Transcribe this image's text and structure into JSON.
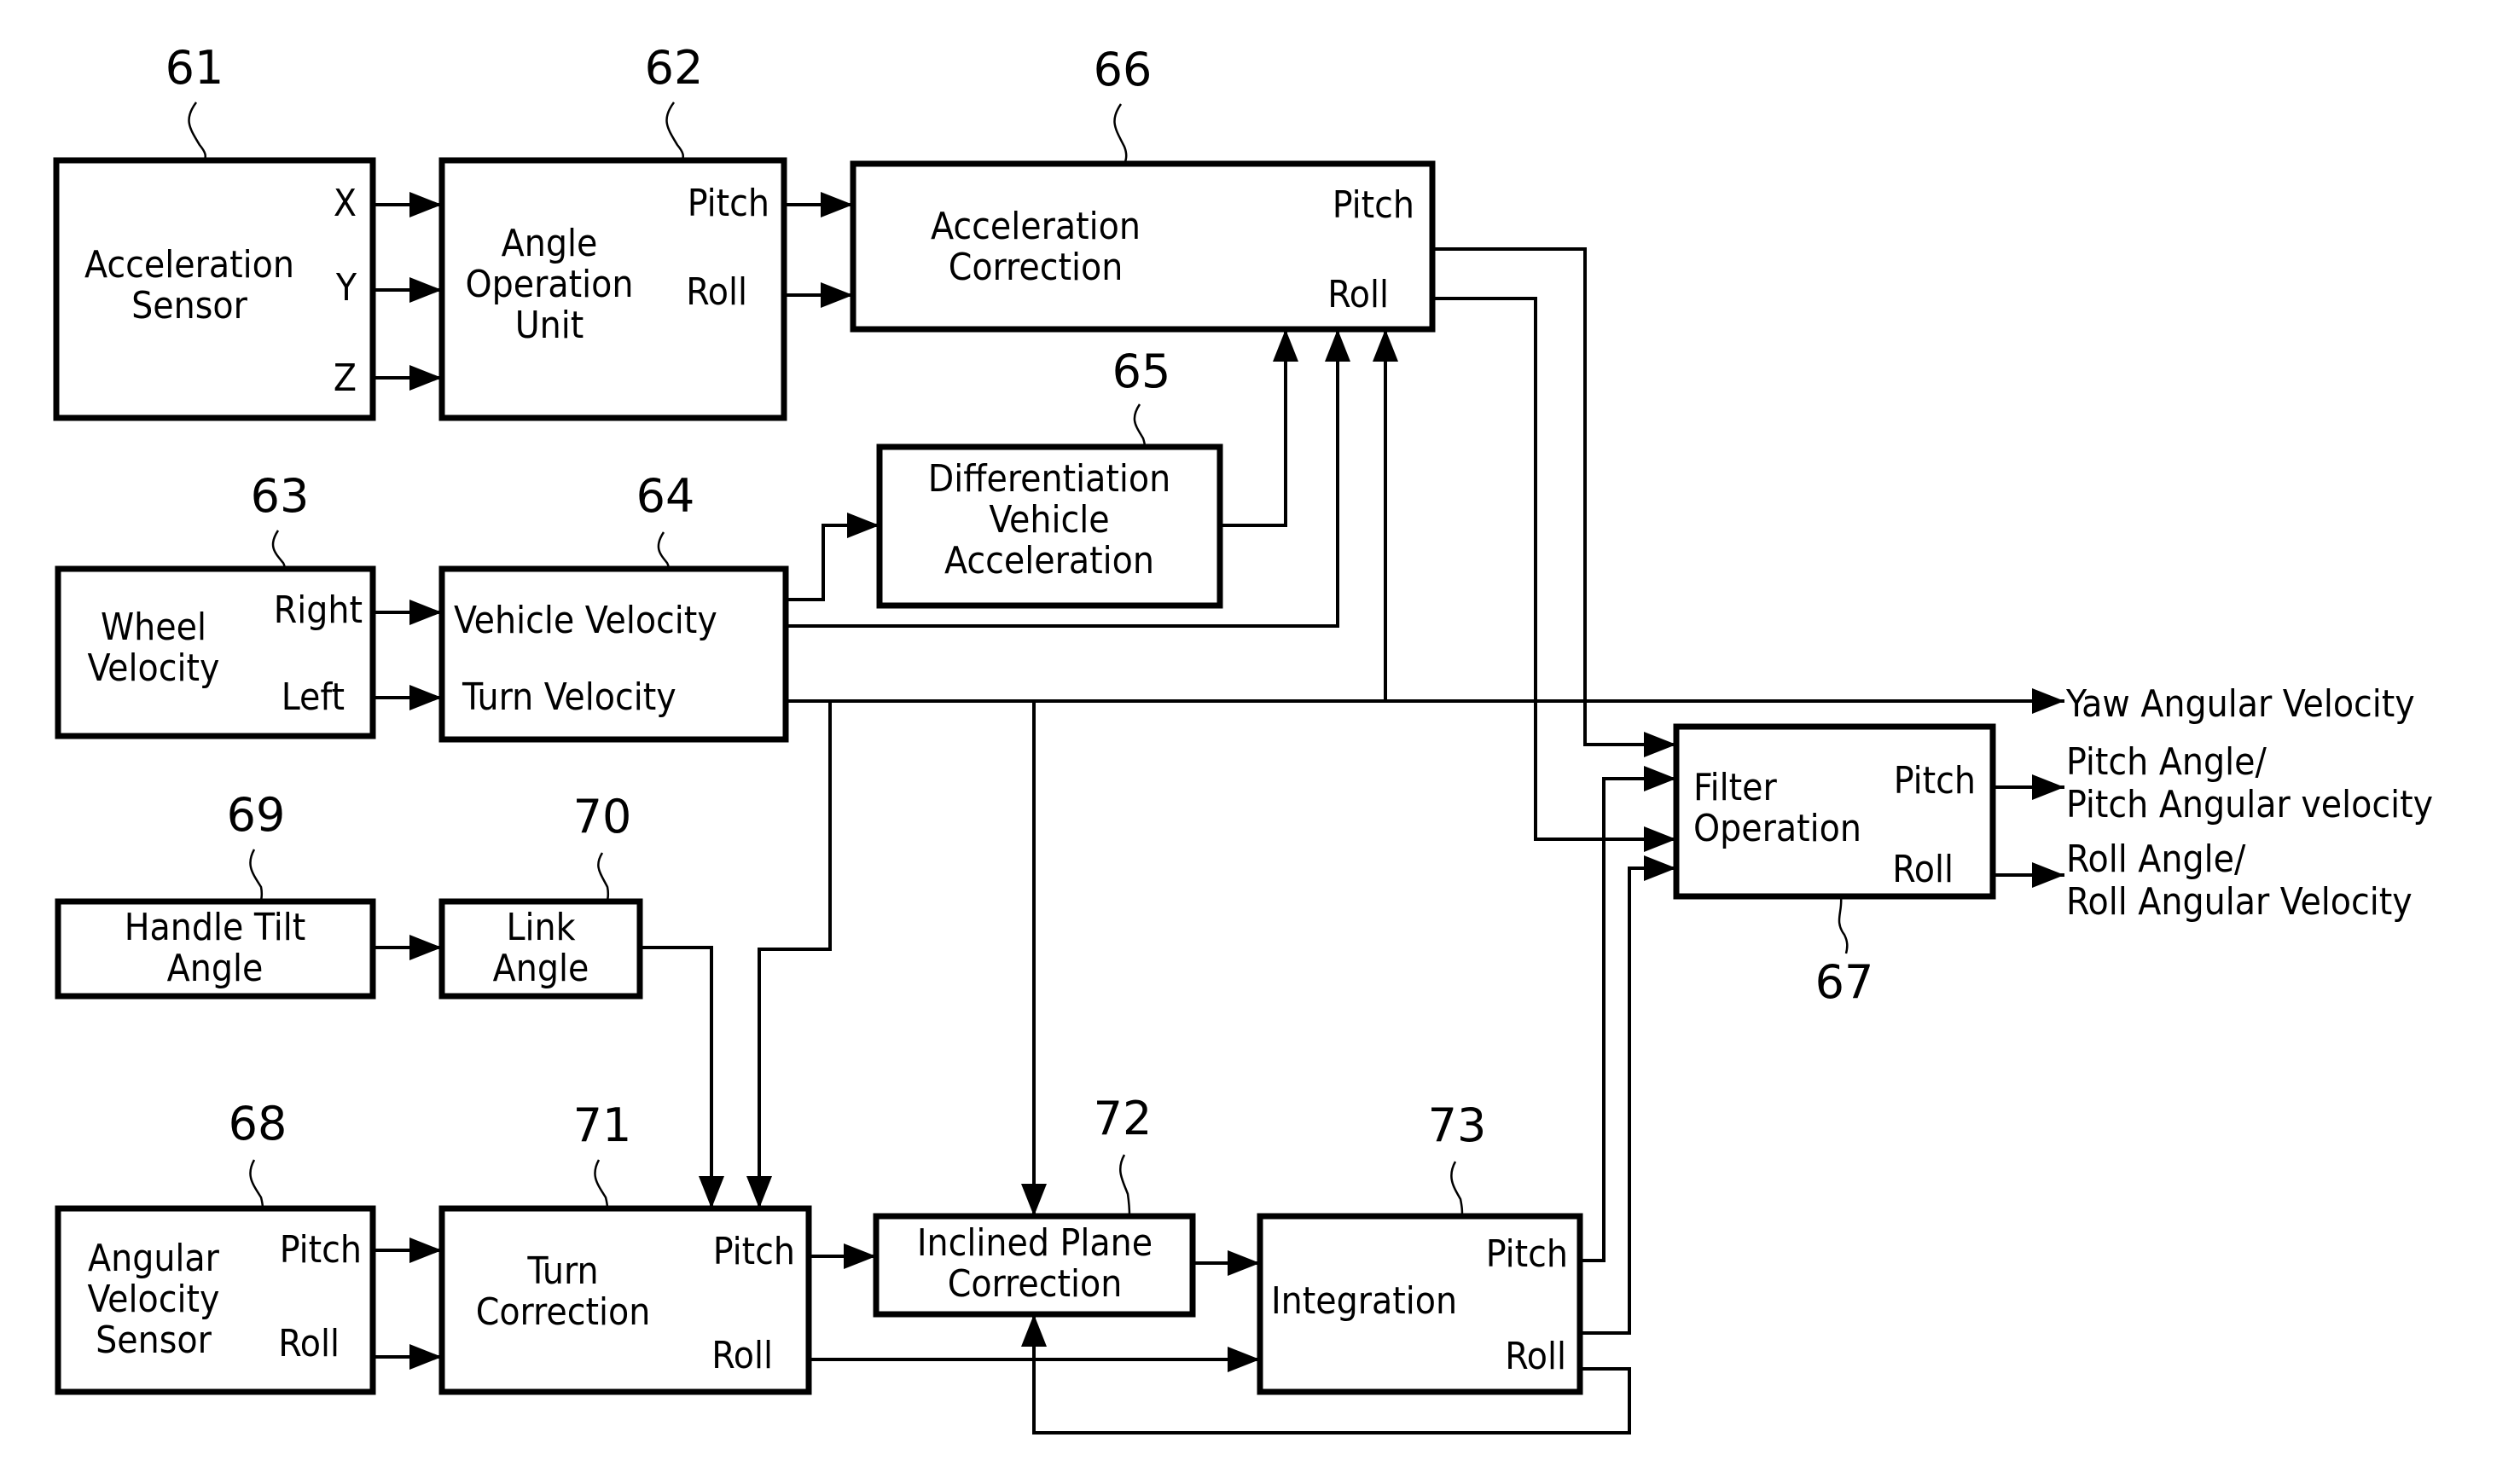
{
  "diagram": {
    "colors": {
      "line": "#000000",
      "background": "#ffffff"
    },
    "blocks": {
      "b61": {
        "ref": "61",
        "title": [
          "Acceleration",
          "Sensor"
        ],
        "ports_out": [
          "X",
          "Y",
          "Z"
        ]
      },
      "b62": {
        "ref": "62",
        "title": [
          "Angle",
          "Operation",
          "Unit"
        ],
        "ports_out": [
          "Pitch",
          "Roll"
        ]
      },
      "b66": {
        "ref": "66",
        "title": [
          "Acceleration",
          "Correction"
        ],
        "ports_out": [
          "Pitch",
          "Roll"
        ]
      },
      "b65": {
        "ref": "65",
        "title": [
          "Differentiation",
          "Vehicle",
          "Acceleration"
        ]
      },
      "b63": {
        "ref": "63",
        "title": [
          "Wheel",
          "Velocity"
        ],
        "ports_out": [
          "Right",
          "Left"
        ]
      },
      "b64": {
        "ref": "64",
        "ports": [
          "Vehicle Velocity",
          "Turn Velocity"
        ]
      },
      "b69": {
        "ref": "69",
        "title": [
          "Handle Tilt",
          "Angle"
        ]
      },
      "b70": {
        "ref": "70",
        "title": [
          "Link",
          "Angle"
        ]
      },
      "b68": {
        "ref": "68",
        "title": [
          "Angular",
          "Velocity",
          "Sensor"
        ],
        "ports_out": [
          "Pitch",
          "Roll"
        ]
      },
      "b71": {
        "ref": "71",
        "title": [
          "Turn",
          "Correction"
        ],
        "ports_out": [
          "Pitch",
          "Roll"
        ]
      },
      "b72": {
        "ref": "72",
        "title": [
          "Inclined Plane",
          "Correction"
        ]
      },
      "b73": {
        "ref": "73",
        "title": [
          "Integration"
        ],
        "ports_out": [
          "Pitch",
          "Roll"
        ]
      },
      "b67": {
        "ref": "67",
        "title": [
          "Filter",
          "Operation"
        ],
        "ports_out": [
          "Pitch",
          "Roll"
        ]
      }
    },
    "outputs": {
      "yaw": "Yaw Angular Velocity",
      "pitch": [
        "Pitch Angle/",
        "Pitch Angular velocity"
      ],
      "roll": [
        "Roll Angle/",
        "Roll Angular Velocity"
      ]
    }
  }
}
